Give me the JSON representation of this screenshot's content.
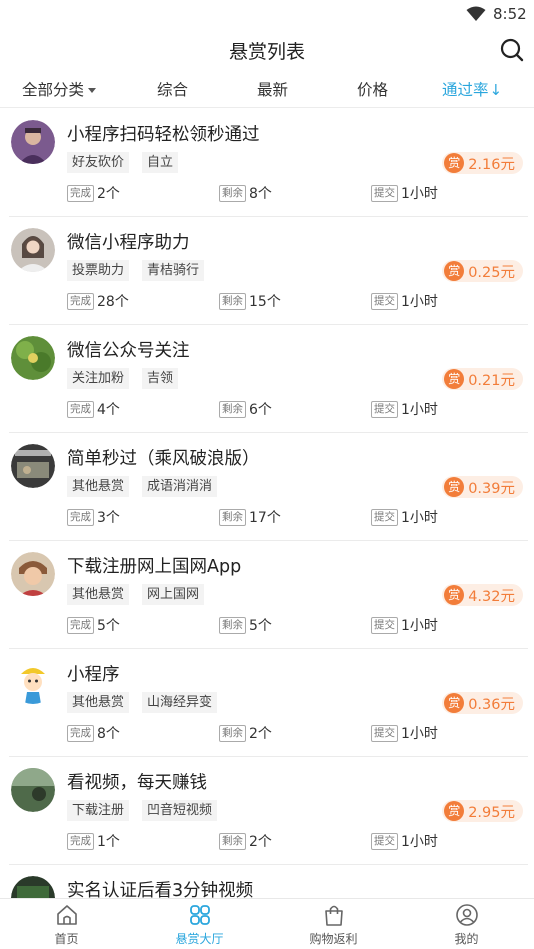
{
  "status_bar": {
    "time": "8:52",
    "wifi_icon": "wifi-icon"
  },
  "header": {
    "title": "悬赏列表",
    "search_icon": "search-icon"
  },
  "filters": {
    "category": "全部分类",
    "comprehensive": "综合",
    "latest": "最新",
    "price": "价格",
    "pass_rate": "通过率",
    "pass_rate_arrow": "↓"
  },
  "labels": {
    "reward_icon": "赏",
    "done": "完成",
    "remaining": "剩余",
    "submit": "提交"
  },
  "tasks": [
    {
      "title": "小程序扫码轻松领秒通过",
      "tags": [
        "好友砍价",
        "自立"
      ],
      "reward": "2.16元",
      "done": "2个",
      "remaining": "8个",
      "submit": "1小时"
    },
    {
      "title": "微信小程序助力",
      "tags": [
        "投票助力",
        "青桔骑行"
      ],
      "reward": "0.25元",
      "done": "28个",
      "remaining": "15个",
      "submit": "1小时"
    },
    {
      "title": "微信公众号关注",
      "tags": [
        "关注加粉",
        "吉领"
      ],
      "reward": "0.21元",
      "done": "4个",
      "remaining": "6个",
      "submit": "1小时"
    },
    {
      "title": "简单秒过（乘风破浪版）",
      "tags": [
        "其他悬赏",
        "成语消消消"
      ],
      "reward": "0.39元",
      "done": "3个",
      "remaining": "17个",
      "submit": "1小时"
    },
    {
      "title": "下载注册网上国网App",
      "tags": [
        "其他悬赏",
        "网上国网"
      ],
      "reward": "4.32元",
      "done": "5个",
      "remaining": "5个",
      "submit": "1小时"
    },
    {
      "title": "小程序",
      "tags": [
        "其他悬赏",
        "山海经异变"
      ],
      "reward": "0.36元",
      "done": "8个",
      "remaining": "2个",
      "submit": "1小时"
    },
    {
      "title": "看视频，每天赚钱",
      "tags": [
        "下载注册",
        "凹音短视频"
      ],
      "reward": "2.95元",
      "done": "1个",
      "remaining": "2个",
      "submit": "1小时"
    },
    {
      "title": "实名认证后看3分钟视频",
      "tags": [],
      "reward": "",
      "done": "",
      "remaining": "",
      "submit": ""
    }
  ],
  "tab_bar": [
    {
      "label": "首页",
      "icon": "home-icon"
    },
    {
      "label": "悬赏大厅",
      "icon": "reward-hall-icon"
    },
    {
      "label": "购物返利",
      "icon": "shopping-bag-icon"
    },
    {
      "label": "我的",
      "icon": "profile-icon"
    }
  ],
  "colors": {
    "accent": "#2aa6dd",
    "reward": "#f27d3a",
    "reward_bg": "#fdeee4"
  }
}
